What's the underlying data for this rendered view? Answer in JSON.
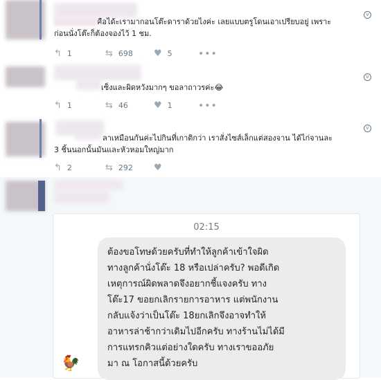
{
  "tweets": [
    {
      "text_line1": "คือได้ะเรามากอนโต๊ะดาราด้วยไงค่ะ  เลยแบบตรูโดนเอาเปรียบอยู่ เพราะ",
      "text_line2": "ก่อนนั่งโต๊ะก็ต้องจองไว้ 1 ชม.",
      "replies": "1",
      "retweets": "698",
      "likes": "5"
    },
    {
      "text_line1": "เซ็งและผิดหวังมากๆ  ขอลาถาวรค่ะ😂",
      "replies": "1",
      "retweets": "46",
      "likes": "1"
    },
    {
      "text_line1": "ลาเหมือนกันค่ะไปกินที่เกาติกว่า  เราสั่งไซส์เล็กแต่สองจาน  ได้ไก่จานละ",
      "text_line2": "3 ชิ้นนอกนั้นมันและหัวหอมใหญ่มาก",
      "replies": "2",
      "retweets": "292",
      "likes": ""
    }
  ],
  "chat": {
    "time": "02:15",
    "lines": [
      "ต้องขอโทษด้วยครับที่ทำให้ลูกค้าเข้าใจผิด",
      "ทางลูกค้านั่งโต๊ะ 18 หรือเปล่าครับ? พอดีเกิด",
      "เหตุการณ์ผิดพลาดจึงอยากชี้แจงครับ  ทาง",
      "โต๊ะ17 ขอยกเลิกรายการอาหาร แต่พนักงาน",
      "กลับแจ้งว่าเป็นโต๊ะ 18ยกเลิกจึงอาจทำให้",
      "อาหารล่าช้ากว่าเดิมไปอีกครับ  ทางร้านไม่ได้มี",
      "การแทรกคิวแต่อย่างใดครับ  ทางเราขออภัย",
      "มา ณ โอกาสนี้ด้วยครับ"
    ]
  },
  "icons": {
    "reply": "reply-icon",
    "retweet": "retweet-icon",
    "like": "heart-icon",
    "more": "more-icon",
    "dropdown": "chevron-down-icon"
  }
}
